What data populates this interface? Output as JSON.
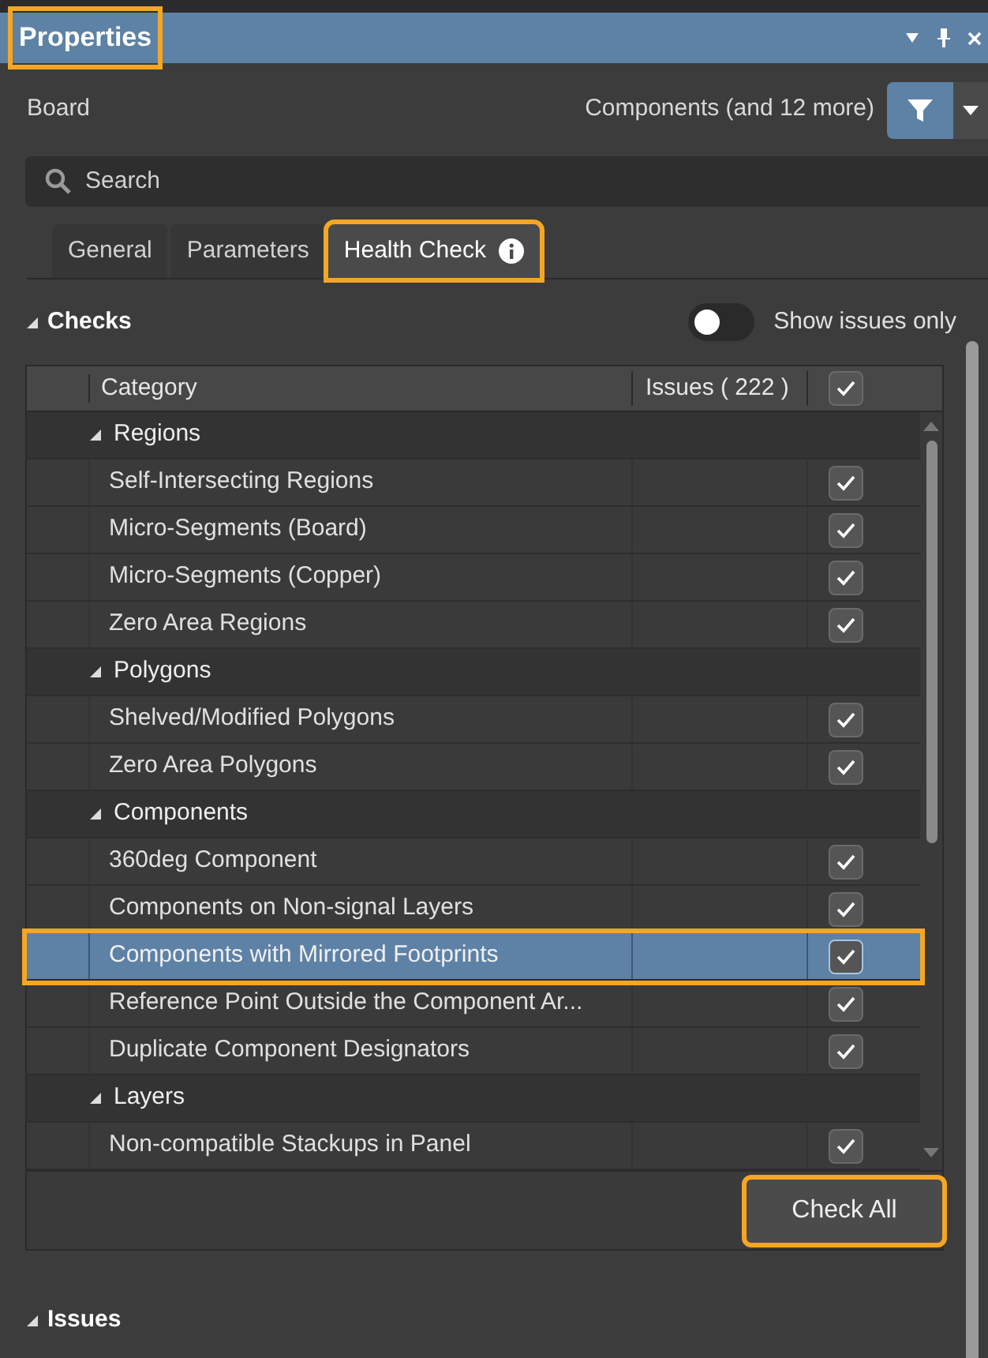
{
  "panel": {
    "title": "Properties",
    "highlighted": true
  },
  "header": {
    "object": "Board",
    "filter_summary": "Components (and 12 more)"
  },
  "search": {
    "placeholder": "Search"
  },
  "tabs": [
    {
      "label": "General",
      "selected": false,
      "info": false,
      "highlighted": false
    },
    {
      "label": "Parameters",
      "selected": false,
      "info": false,
      "highlighted": false
    },
    {
      "label": "Health Check",
      "selected": true,
      "info": true,
      "highlighted": true
    }
  ],
  "checks_section": {
    "title": "Checks",
    "expanded": true,
    "show_issues_only": {
      "label": "Show issues only",
      "on": false
    }
  },
  "table": {
    "columns": [
      "Category",
      "Issues ( 222 )"
    ],
    "all_checked": true,
    "groups": [
      {
        "label": "Regions",
        "expanded": true,
        "children": [
          {
            "label": "Self-Intersecting Regions",
            "checked": true,
            "selected": false,
            "highlighted": false
          },
          {
            "label": "Micro-Segments (Board)",
            "checked": true,
            "selected": false,
            "highlighted": false
          },
          {
            "label": "Micro-Segments (Copper)",
            "checked": true,
            "selected": false,
            "highlighted": false
          },
          {
            "label": "Zero Area Regions",
            "checked": true,
            "selected": false,
            "highlighted": false
          }
        ]
      },
      {
        "label": "Polygons",
        "expanded": true,
        "children": [
          {
            "label": "Shelved/Modified Polygons",
            "checked": true,
            "selected": false,
            "highlighted": false
          },
          {
            "label": "Zero Area Polygons",
            "checked": true,
            "selected": false,
            "highlighted": false
          }
        ]
      },
      {
        "label": "Components",
        "expanded": true,
        "children": [
          {
            "label": "360deg Component",
            "checked": true,
            "selected": false,
            "highlighted": false
          },
          {
            "label": "Components on Non-signal Layers",
            "checked": true,
            "selected": false,
            "highlighted": false
          },
          {
            "label": "Components with Mirrored Footprints",
            "checked": true,
            "selected": true,
            "highlighted": true
          },
          {
            "label": "Reference Point Outside the Component Ar...",
            "checked": true,
            "selected": false,
            "highlighted": false
          },
          {
            "label": "Duplicate Component Designators",
            "checked": true,
            "selected": false,
            "highlighted": false
          }
        ]
      },
      {
        "label": "Layers",
        "expanded": true,
        "children": [
          {
            "label": "Non-compatible Stackups in Panel",
            "checked": true,
            "selected": false,
            "highlighted": false
          }
        ]
      }
    ]
  },
  "check_all_button": {
    "label": "Check All",
    "highlighted": true
  },
  "issues_section": {
    "title": "Issues",
    "expanded": true
  }
}
